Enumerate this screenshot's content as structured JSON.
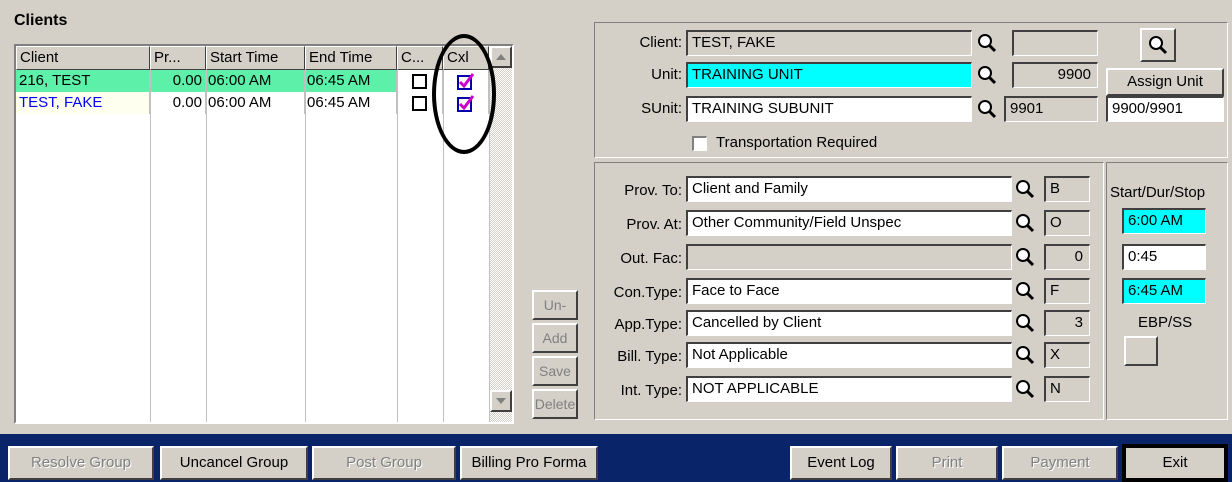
{
  "clients_panel": {
    "title": "Clients",
    "columns": [
      "Client",
      "Pr...",
      "Start Time",
      "End Time",
      "C...",
      "Cxl"
    ],
    "rows": [
      {
        "client": "216, TEST",
        "pr": "0.00",
        "start": "06:00 AM",
        "end": "06:45 AM",
        "c_checked": false,
        "cxl_checked": true,
        "selected": true
      },
      {
        "client": "TEST, FAKE",
        "pr": "0.00",
        "start": "06:00 AM",
        "end": "06:45 AM",
        "c_checked": false,
        "cxl_checked": true,
        "selected": false
      }
    ]
  },
  "side_buttons": {
    "uncxl": "Un-Cxl",
    "add": "Add",
    "save": "Save",
    "delete": "Delete"
  },
  "client_info": {
    "client_label": "Client:",
    "client_value": "TEST, FAKE",
    "client_code": "",
    "unit_label": "Unit:",
    "unit_value": "TRAINING UNIT",
    "unit_code": "9900",
    "sunit_label": "SUnit:",
    "sunit_value": "TRAINING SUBUNIT",
    "sunit_code": "9901",
    "assign_unit_label": "Assign Unit",
    "assign_unit_value": "9900/9901",
    "transport_label": "Transportation Required",
    "transport_checked": false
  },
  "service": {
    "prov_to_label": "Prov. To:",
    "prov_to_value": "Client and Family",
    "prov_to_code": "B",
    "prov_at_label": "Prov. At:",
    "prov_at_value": "Other Community/Field Unspec",
    "prov_at_code": "O",
    "out_fac_label": "Out. Fac:",
    "out_fac_value": "",
    "out_fac_code": "0",
    "con_type_label": "Con.Type:",
    "con_type_value": "Face to Face",
    "con_type_code": "F",
    "app_type_label": "App.Type:",
    "app_type_value": "Cancelled by Client",
    "app_type_code": "3",
    "bill_type_label": "Bill. Type:",
    "bill_type_value": "Not Applicable",
    "bill_type_code": "X",
    "int_type_label": "Int. Type:",
    "int_type_value": "NOT APPLICABLE",
    "int_type_code": "N"
  },
  "timing": {
    "label": "Start/Dur/Stop",
    "start": "6:00 AM",
    "duration": "0:45",
    "stop": "6:45 AM",
    "ebp_label": "EBP/SS"
  },
  "bottom_bar": {
    "resolve_group": "Resolve Group",
    "uncancel_group": "Uncancel Group",
    "post_group": "Post Group",
    "billing_pro_forma": "Billing Pro Forma",
    "event_log": "Event Log",
    "print": "Print",
    "payment": "Payment",
    "exit": "Exit"
  },
  "colors": {
    "selected_row": "#5cf0a8",
    "highlight_row": "#fffff0",
    "cyan_field": "#00ffff",
    "bottom_bar": "#0a246a",
    "window_bg": "#d4d0c8",
    "cxl_check": "#cc00cc"
  }
}
